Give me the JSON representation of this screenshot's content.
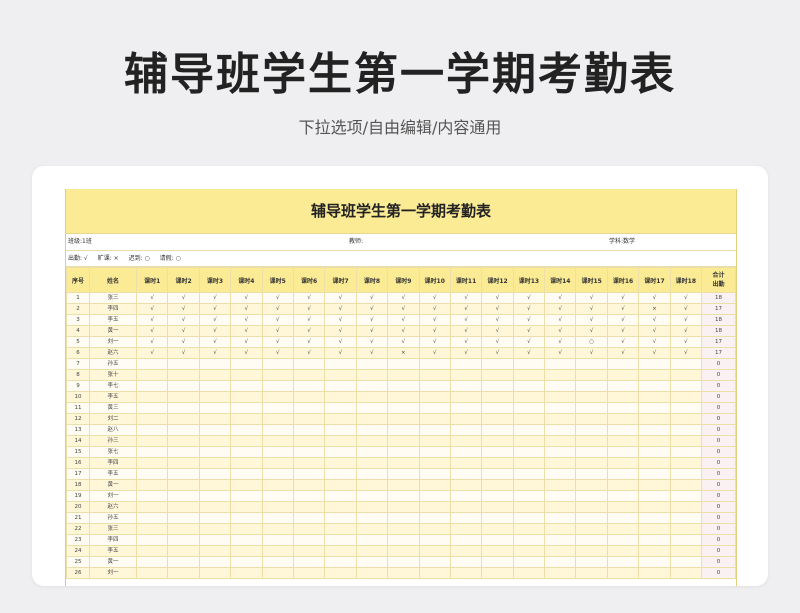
{
  "hero": {
    "title": "辅导班学生第一学期考勤表",
    "subtitle": "下拉选项/自由编辑/内容通用"
  },
  "sheet": {
    "title": "辅导班学生第一学期考勤表",
    "class_label": "班级:1班",
    "teacher_label": "教师:",
    "subject_label": "学科:数学",
    "legend": [
      "出勤: √",
      "旷课: ×",
      "迟到: ○",
      "请假: ○"
    ],
    "headers": {
      "index": "序号",
      "name": "姓名",
      "lessons": [
        "课时1",
        "课时2",
        "课时3",
        "课时4",
        "课时5",
        "课时6",
        "课时7",
        "课时8",
        "课时9",
        "课时10",
        "课时11",
        "课时12",
        "课时13",
        "课时14",
        "课时15",
        "课时16",
        "课时17",
        "课时18"
      ],
      "total": "合计\n出勤"
    },
    "rows": [
      {
        "n": "1",
        "name": "张三",
        "marks": [
          "√",
          "√",
          "√",
          "√",
          "√",
          "√",
          "√",
          "√",
          "√",
          "√",
          "√",
          "√",
          "√",
          "√",
          "√",
          "√",
          "√",
          "√"
        ],
        "total": "18"
      },
      {
        "n": "2",
        "name": "李四",
        "marks": [
          "√",
          "√",
          "√",
          "√",
          "√",
          "√",
          "√",
          "√",
          "√",
          "√",
          "√",
          "√",
          "√",
          "√",
          "√",
          "√",
          "×",
          "√"
        ],
        "total": "17"
      },
      {
        "n": "3",
        "name": "李五",
        "marks": [
          "√",
          "√",
          "√",
          "√",
          "√",
          "√",
          "√",
          "√",
          "√",
          "√",
          "√",
          "√",
          "√",
          "√",
          "√",
          "√",
          "√",
          "√"
        ],
        "total": "18"
      },
      {
        "n": "4",
        "name": "黄一",
        "marks": [
          "√",
          "√",
          "√",
          "√",
          "√",
          "√",
          "√",
          "√",
          "√",
          "√",
          "√",
          "√",
          "√",
          "√",
          "√",
          "√",
          "√",
          "√"
        ],
        "total": "18"
      },
      {
        "n": "5",
        "name": "刘一",
        "marks": [
          "√",
          "√",
          "√",
          "√",
          "√",
          "√",
          "√",
          "√",
          "√",
          "√",
          "√",
          "√",
          "√",
          "√",
          "○",
          "√",
          "√",
          "√"
        ],
        "total": "17"
      },
      {
        "n": "6",
        "name": "赵六",
        "marks": [
          "√",
          "√",
          "√",
          "√",
          "√",
          "√",
          "√",
          "√",
          "×",
          "√",
          "√",
          "√",
          "√",
          "√",
          "√",
          "√",
          "√",
          "√"
        ],
        "total": "17"
      },
      {
        "n": "7",
        "name": "孙五",
        "marks": [],
        "total": "0"
      },
      {
        "n": "8",
        "name": "张十",
        "marks": [],
        "total": "0"
      },
      {
        "n": "9",
        "name": "李七",
        "marks": [],
        "total": "0"
      },
      {
        "n": "10",
        "name": "李五",
        "marks": [],
        "total": "0"
      },
      {
        "n": "11",
        "name": "黄三",
        "marks": [],
        "total": "0"
      },
      {
        "n": "12",
        "name": "刘二",
        "marks": [],
        "total": "0"
      },
      {
        "n": "13",
        "name": "赵八",
        "marks": [],
        "total": "0"
      },
      {
        "n": "14",
        "name": "孙三",
        "marks": [],
        "total": "0"
      },
      {
        "n": "15",
        "name": "张七",
        "marks": [],
        "total": "0"
      },
      {
        "n": "16",
        "name": "李四",
        "marks": [],
        "total": "0"
      },
      {
        "n": "17",
        "name": "李五",
        "marks": [],
        "total": "0"
      },
      {
        "n": "18",
        "name": "黄一",
        "marks": [],
        "total": "0"
      },
      {
        "n": "19",
        "name": "刘一",
        "marks": [],
        "total": "0"
      },
      {
        "n": "20",
        "name": "赵六",
        "marks": [],
        "total": "0"
      },
      {
        "n": "21",
        "name": "孙五",
        "marks": [],
        "total": "0"
      },
      {
        "n": "22",
        "name": "张三",
        "marks": [],
        "total": "0"
      },
      {
        "n": "23",
        "name": "李四",
        "marks": [],
        "total": "0"
      },
      {
        "n": "24",
        "name": "李五",
        "marks": [],
        "total": "0"
      },
      {
        "n": "25",
        "name": "黄一",
        "marks": [],
        "total": "0"
      },
      {
        "n": "26",
        "name": "刘一",
        "marks": [],
        "total": "0"
      }
    ]
  }
}
